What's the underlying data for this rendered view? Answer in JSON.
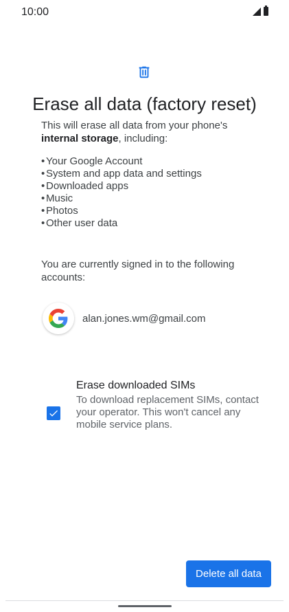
{
  "status_bar": {
    "time": "10:00"
  },
  "page": {
    "title": "Erase all data (factory reset)",
    "intro_prefix": "This will erase all data from your phone's",
    "intro_bold": "internal storage",
    "intro_suffix": ", including:",
    "items": [
      "Your Google Account",
      "System and app data and settings",
      "Downloaded apps",
      "Music",
      "Photos",
      "Other user data"
    ],
    "signed_in_text": "You are currently signed in to the following accounts:",
    "account_email": "alan.jones.wm@gmail.com"
  },
  "esim_option": {
    "title": "Erase downloaded SIMs",
    "description": "To download replacement SIMs, contact your operator. This won't cancel any mobile service plans.",
    "checked": true
  },
  "actions": {
    "delete_button": "Delete all data"
  },
  "colors": {
    "accent": "#1a73e8"
  },
  "icons": [
    "signal-icon",
    "battery-icon",
    "trash-icon",
    "google-logo-icon",
    "check-icon"
  ]
}
